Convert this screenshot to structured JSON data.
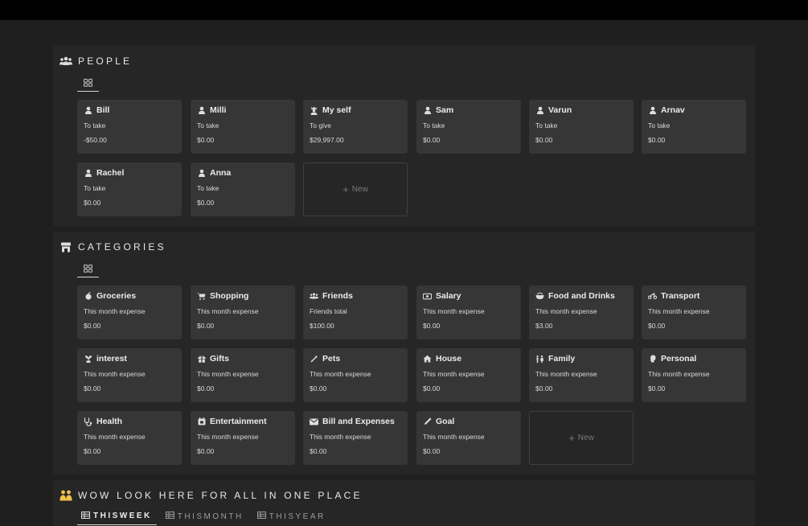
{
  "people": {
    "title": "PEOPLE",
    "cards": [
      {
        "name": "Bill",
        "label": "To take",
        "amount": "-$50.00"
      },
      {
        "name": "Milli",
        "label": "To take",
        "amount": "$0.00"
      },
      {
        "name": "My self",
        "label": "To give",
        "amount": "$29,997.00"
      },
      {
        "name": "Sam",
        "label": "To take",
        "amount": "$0.00"
      },
      {
        "name": "Varun",
        "label": "To take",
        "amount": "$0.00"
      },
      {
        "name": "Arnav",
        "label": "To take",
        "amount": "$0.00"
      },
      {
        "name": "Rachel",
        "label": "To take",
        "amount": "$0.00"
      },
      {
        "name": "Anna",
        "label": "To take",
        "amount": "$0.00"
      }
    ],
    "new_label": "New"
  },
  "categories": {
    "title": "CATEGORIES",
    "cards": [
      {
        "name": "Groceries",
        "label": "This month expense",
        "amount": "$0.00",
        "icon": "apple-icon"
      },
      {
        "name": "Shopping",
        "label": "This month expense",
        "amount": "$0.00",
        "icon": "cart-icon"
      },
      {
        "name": "Friends",
        "label": "Friends total",
        "amount": "$100.00",
        "icon": "group-icon"
      },
      {
        "name": "Salary",
        "label": "This month expense",
        "amount": "$0.00",
        "icon": "money-icon"
      },
      {
        "name": "Food and Drinks",
        "label": "This month expense",
        "amount": "$3.00",
        "icon": "bowl-icon"
      },
      {
        "name": "Transport",
        "label": "This month expense",
        "amount": "$0.00",
        "icon": "motorcycle-icon"
      },
      {
        "name": "interest",
        "label": "This month expense",
        "amount": "$0.00",
        "icon": "plant-icon"
      },
      {
        "name": "Gifts",
        "label": "This month expense",
        "amount": "$0.00",
        "icon": "gift-icon"
      },
      {
        "name": "Pets",
        "label": "This month expense",
        "amount": "$0.00",
        "icon": "wand-icon"
      },
      {
        "name": "House",
        "label": "This month expense",
        "amount": "$0.00",
        "icon": "house-icon"
      },
      {
        "name": "Family",
        "label": "This month expense",
        "amount": "$0.00",
        "icon": "family-icon"
      },
      {
        "name": "Personal",
        "label": "This month expense",
        "amount": "$0.00",
        "icon": "person-head-icon"
      },
      {
        "name": "Health",
        "label": "This month expense",
        "amount": "$0.00",
        "icon": "stethoscope-icon"
      },
      {
        "name": "Entertainment",
        "label": "This month expense",
        "amount": "$0.00",
        "icon": "calendar-icon"
      },
      {
        "name": "Bill and Expenses",
        "label": "This month expense",
        "amount": "$0.00",
        "icon": "envelope-icon"
      },
      {
        "name": "Goal",
        "label": "This month expense",
        "amount": "$0.00",
        "icon": "pen-icon"
      }
    ],
    "new_label": "New"
  },
  "wow": {
    "title": "WOW LOOK HERE FOR ALL IN ONE PLACE",
    "tabs": [
      "THISWEEK",
      "THISMONTH",
      "THISYEAR"
    ]
  }
}
